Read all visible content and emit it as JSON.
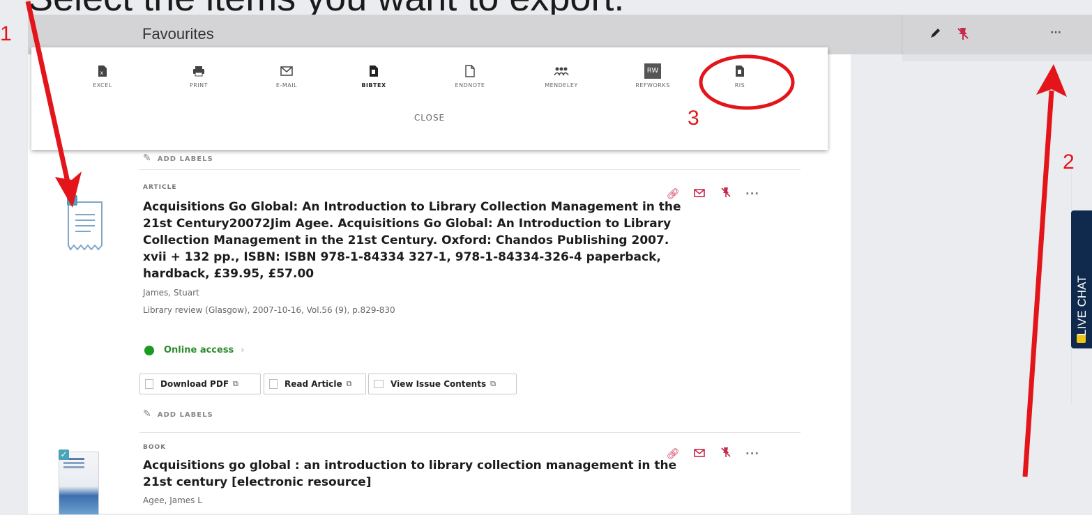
{
  "slide": {
    "title": "Select the items you want to export."
  },
  "topbar": {
    "title": "Favourites",
    "edit_icon": "pencil-icon",
    "unpin_icon": "unpin-icon",
    "more_label": "···"
  },
  "export_menu": {
    "items": [
      {
        "icon": "excel-icon",
        "label": "EXCEL"
      },
      {
        "icon": "print-icon",
        "label": "PRINT"
      },
      {
        "icon": "email-icon",
        "label": "E-MAIL"
      },
      {
        "icon": "bibtex-icon",
        "label": "BIBTEX"
      },
      {
        "icon": "endnote-icon",
        "label": "ENDNOTE"
      },
      {
        "icon": "mendeley-icon",
        "label": "MENDELEY"
      },
      {
        "icon": "refworks-icon",
        "label": "REFWORKS",
        "badge": "RW"
      },
      {
        "icon": "ris-icon",
        "label": "RIS"
      }
    ],
    "close_label": "CLOSE"
  },
  "add_labels": "ADD LABELS",
  "results": [
    {
      "type": "ARTICLE",
      "title_lines": [
        "Acquisitions Go Global: An Introduction to Library Collection Management in the",
        "21st Century20072Jim Agee. Acquisitions Go Global: An Introduction to Library",
        "Collection Management in the 21st Century. Oxford: Chandos Publishing 2007.",
        "xvii + 132 pp., ISBN: ISBN 978-1-84334 327-1, 978-1-84334-326-4 paperback,",
        "hardback, £39.95, £57.00"
      ],
      "author": "James, Stuart",
      "source": "Library review (Glasgow), 2007-10-16, Vol.56 (9), p.829-830",
      "availability": "Online access",
      "links": [
        "Download PDF",
        "Read Article",
        "View Issue Contents"
      ]
    },
    {
      "type": "BOOK",
      "title_lines": [
        "Acquisitions go global : an introduction to library collection management in the",
        "21st century [electronic resource]"
      ],
      "author": "Agee, James L"
    }
  ],
  "live_chat": "LIVE CHAT",
  "annotations": {
    "callout_1": "1",
    "callout_2": "2",
    "callout_3": "3",
    "color": "#e3151a"
  }
}
